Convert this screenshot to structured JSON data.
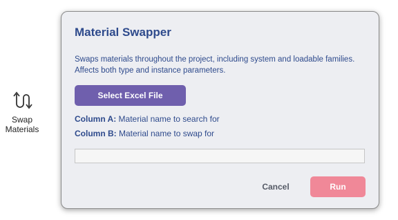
{
  "ribbon": {
    "button_label_line1": "Swap",
    "button_label_line2": "Materials",
    "icon": "swap-arrows-icon"
  },
  "dialog": {
    "title": "Material Swapper",
    "description_line1": "Swaps materials throughout the project, including system and loadable families.",
    "description_line2": "Affects both type and instance parameters.",
    "select_file_label": "Select Excel File",
    "column_a_label": "Column A:",
    "column_a_text": " Material name to search for",
    "column_b_label": "Column B:",
    "column_b_text": " Material name to swap for",
    "progress": 0,
    "cancel_label": "Cancel",
    "run_label": "Run"
  },
  "colors": {
    "accent_purple": "#6f5fad",
    "title_blue": "#2e4a8c",
    "run_pink": "#f08898",
    "dialog_bg": "#edeef2"
  }
}
